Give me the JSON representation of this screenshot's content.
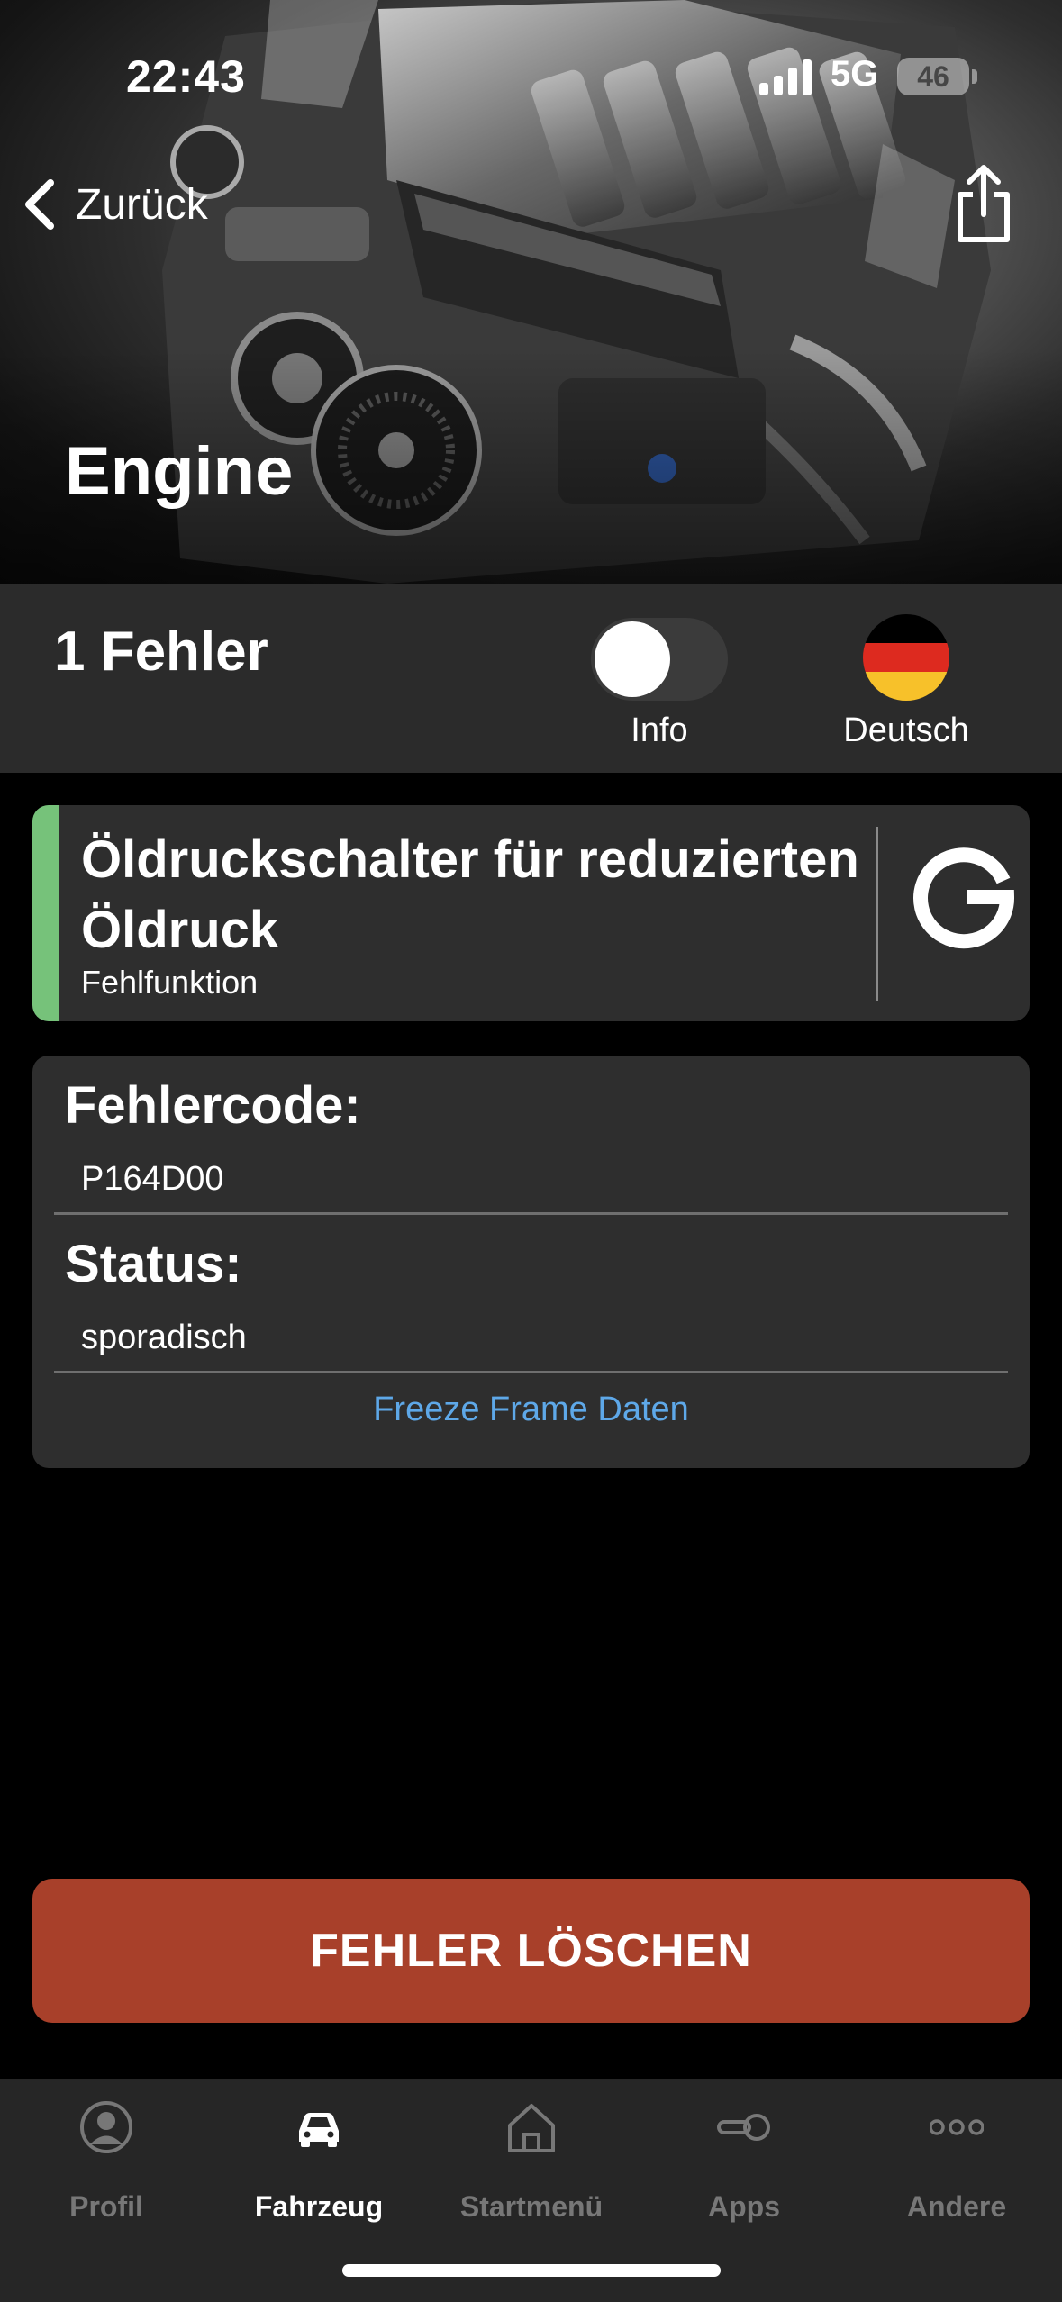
{
  "status_bar": {
    "time": "22:43",
    "network": "5G",
    "battery": "46"
  },
  "nav": {
    "back_label": "Zurück",
    "back_icon": "chevron-left-icon",
    "share_icon": "share-icon"
  },
  "header": {
    "title": "Engine"
  },
  "summary": {
    "error_count": "1 Fehler",
    "info_toggle_label": "Info",
    "info_toggle_on": false,
    "language_label": "Deutsch",
    "language_flag": "germany-flag-icon"
  },
  "fault": {
    "title": "Öldruckschalter für reduzierten Öldruck",
    "subtitle": "Fehlfunktion",
    "accent_color": "#76c27a",
    "search_icon": "google-icon"
  },
  "details": {
    "code_label": "Fehlercode:",
    "code_value": "P164D00",
    "status_label": "Status:",
    "status_value": "sporadisch",
    "freeze_frame_link": "Freeze Frame Daten"
  },
  "actions": {
    "clear_button": "FEHLER LÖSCHEN",
    "clear_color": "#a8402a"
  },
  "tabbar": {
    "items": [
      {
        "label": "Profil",
        "icon": "person-icon",
        "active": false
      },
      {
        "label": "Fahrzeug",
        "icon": "car-icon",
        "active": true
      },
      {
        "label": "Startmenü",
        "icon": "home-icon",
        "active": false
      },
      {
        "label": "Apps",
        "icon": "apps-toggle-icon",
        "active": false
      },
      {
        "label": "Andere",
        "icon": "more-dots-icon",
        "active": false
      }
    ]
  }
}
